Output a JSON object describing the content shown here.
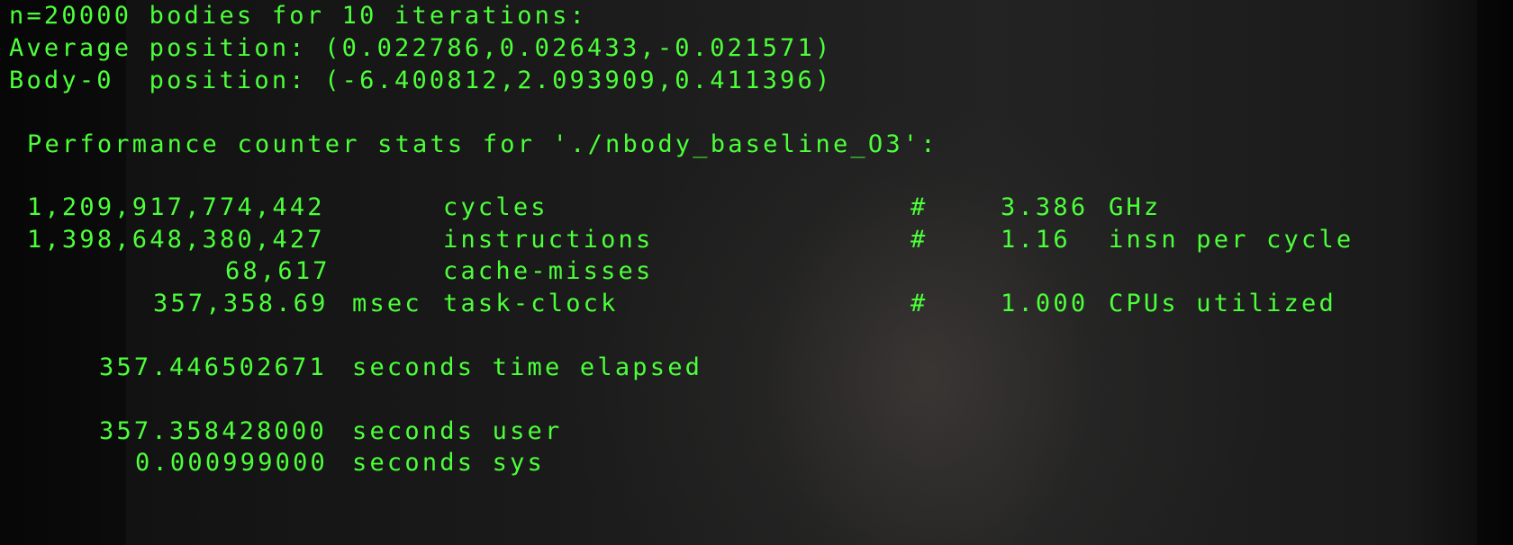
{
  "header": {
    "run": "n=20000 bodies for 10 iterations:",
    "average_position": "Average position: (0.022786,0.026433,-0.021571)",
    "body0_position": "Body-0  position: (-6.400812,2.093909,0.411396)"
  },
  "perf": {
    "title": "Performance counter stats for './nbody_baseline_O3':",
    "counters": [
      {
        "value": "1,209,917,774,442",
        "unit": "",
        "event": "cycles",
        "hash": "#",
        "metric_value": "3.386",
        "metric_unit": "GHz"
      },
      {
        "value": "1,398,648,380,427",
        "unit": "",
        "event": "instructions",
        "hash": "#",
        "metric_value": "1.16",
        "metric_unit": "insn per cycle"
      },
      {
        "value": "68,617",
        "unit": "",
        "event": "cache-misses",
        "hash": "",
        "metric_value": "",
        "metric_unit": ""
      },
      {
        "value": "357,358.69",
        "unit": "msec",
        "event": "task-clock",
        "hash": "#",
        "metric_value": "1.000",
        "metric_unit": "CPUs utilized"
      }
    ],
    "elapsed": {
      "value": "357.446502671",
      "label": "seconds time elapsed"
    },
    "user": {
      "value": "357.358428000",
      "label": "seconds user"
    },
    "sys": {
      "value": "0.000999000",
      "label": "seconds sys"
    }
  }
}
